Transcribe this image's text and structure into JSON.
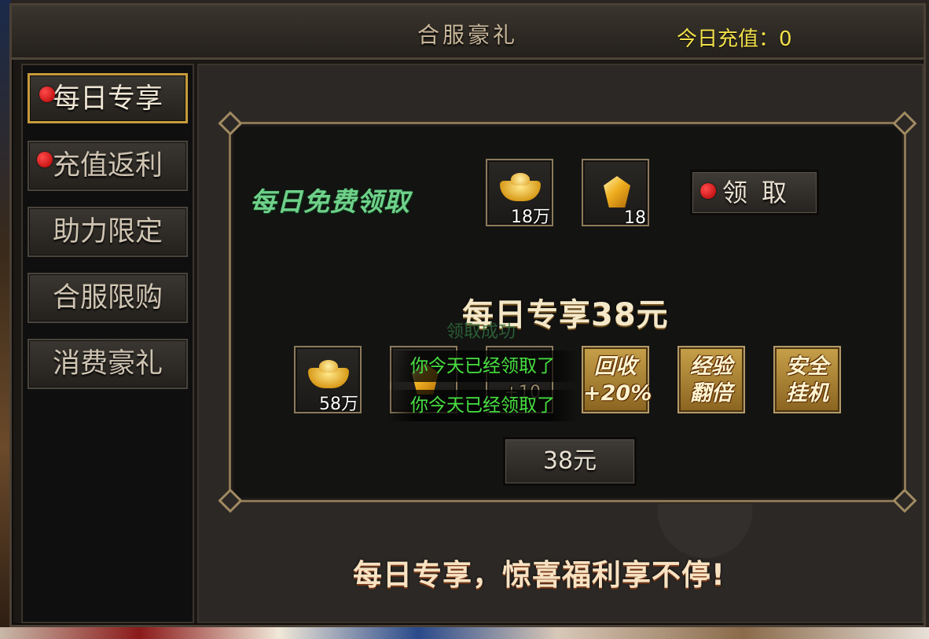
{
  "window": {
    "title": "合服豪礼",
    "recharge_label": "今日充值：0"
  },
  "sidebar": {
    "items": [
      {
        "label": "每日专享",
        "active": true,
        "badge": true
      },
      {
        "label": "充值返利",
        "active": false,
        "badge": true
      },
      {
        "label": "助力限定",
        "active": false,
        "badge": false
      },
      {
        "label": "合服限购",
        "active": false,
        "badge": false
      },
      {
        "label": "消费豪礼",
        "active": false,
        "badge": false
      }
    ]
  },
  "free_reward": {
    "label": "每日免费领取",
    "items": [
      {
        "icon": "gold-ingot-icon",
        "quantity": "18万"
      },
      {
        "icon": "gold-crystal-icon",
        "quantity": "18"
      }
    ],
    "claim_button": "领取"
  },
  "paid_pack": {
    "heading": "每日专享38元",
    "faded_notice": "领取成功",
    "items": [
      {
        "icon": "gold-ingot-icon",
        "quantity": "58万"
      },
      {
        "icon": "gold-crystal-icon",
        "quantity": ""
      },
      {
        "icon": "item-icon",
        "quantity": "+10"
      }
    ],
    "bonuses": [
      "回收+20%",
      "经验翻倍",
      "安全挂机"
    ],
    "bonus_lines": [
      [
        "回收",
        "+20%"
      ],
      [
        "经验",
        "翻倍"
      ],
      [
        "安全",
        "挂机"
      ]
    ],
    "price_button": "38元",
    "notices": [
      "你今天已经领取了",
      "你今天已经领取了"
    ]
  },
  "footer": {
    "slogan": "每日专享，惊喜福利享不停!"
  },
  "colors": {
    "accent_gold": "#c79a3a",
    "notice_green": "#46e040",
    "recharge_yellow": "#f2e04a",
    "free_label_green": "#6fd08a"
  }
}
